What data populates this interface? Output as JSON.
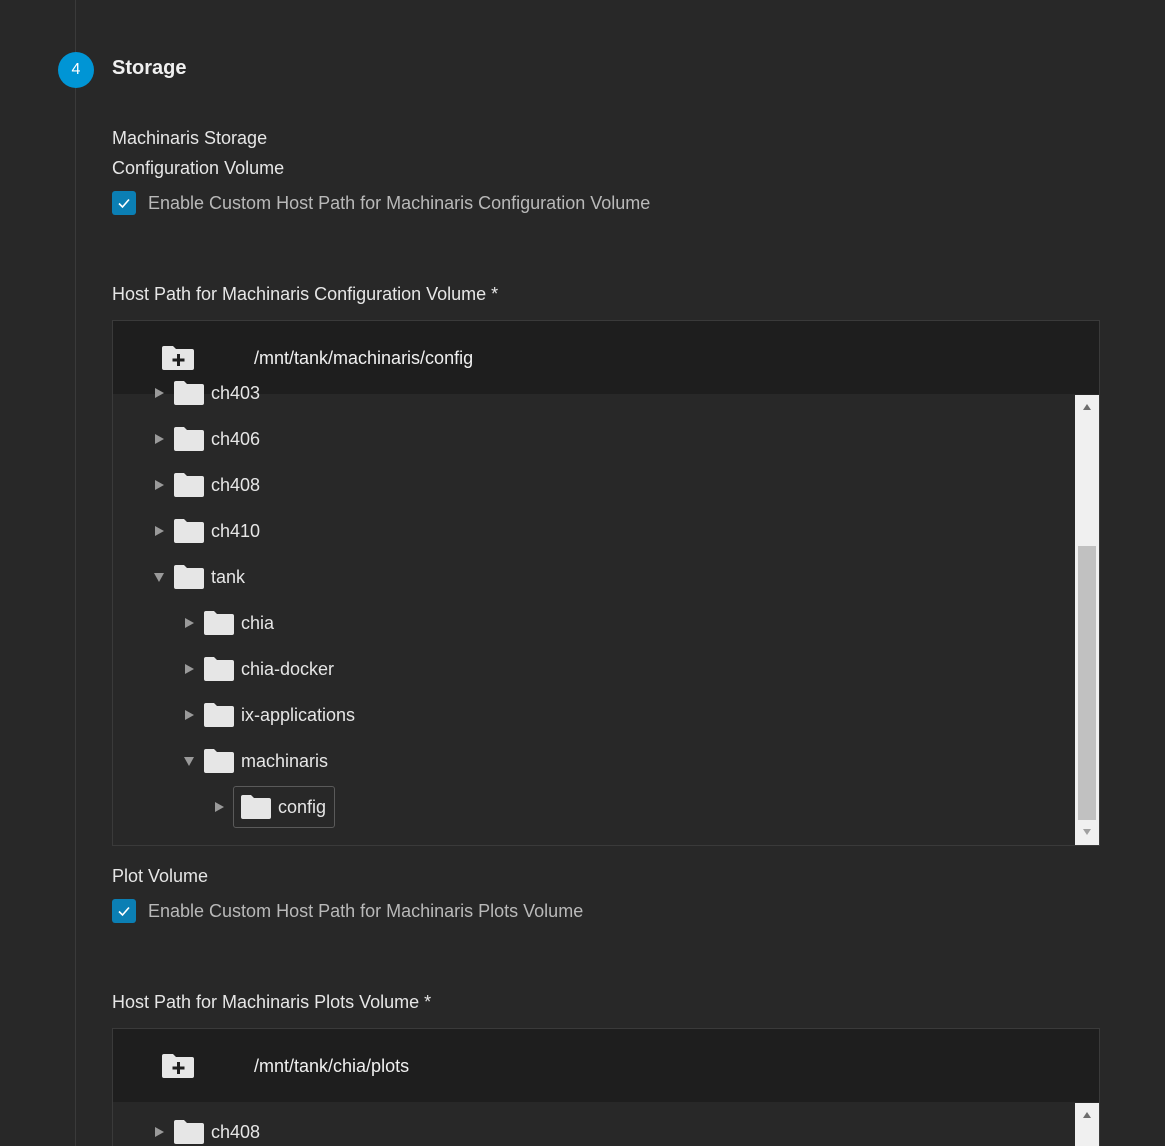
{
  "step": {
    "number": "4",
    "title": "Storage"
  },
  "section_label": "Machinaris Storage",
  "config_volume": {
    "label": "Configuration Volume",
    "checkbox_label": "Enable Custom Host Path for Machinaris Configuration Volume",
    "checked": true,
    "host_path_label": "Host Path for Machinaris Configuration Volume *",
    "path_value": "/mnt/tank/machinaris/config",
    "tree": [
      {
        "name": "ch403",
        "expanded": false
      },
      {
        "name": "ch406",
        "expanded": false
      },
      {
        "name": "ch408",
        "expanded": false
      },
      {
        "name": "ch410",
        "expanded": false
      },
      {
        "name": "tank",
        "expanded": true
      },
      {
        "name": "chia",
        "expanded": false
      },
      {
        "name": "chia-docker",
        "expanded": false
      },
      {
        "name": "ix-applications",
        "expanded": false
      },
      {
        "name": "machinaris",
        "expanded": true
      },
      {
        "name": "config",
        "expanded": false,
        "selected": true
      }
    ]
  },
  "plot_volume": {
    "label": "Plot Volume",
    "checkbox_label": "Enable Custom Host Path for Machinaris Plots Volume",
    "checked": true,
    "host_path_label": "Host Path for Machinaris Plots Volume *",
    "path_value": "/mnt/tank/chia/plots",
    "tree": [
      {
        "name": "ch408",
        "expanded": false
      }
    ]
  },
  "colors": {
    "accent": "#0095d5",
    "checkbox": "#0b7fb4",
    "background": "#282828",
    "header": "#1e1e1e"
  },
  "icons": {
    "new_folder": "folder-plus-icon",
    "folder": "folder-icon",
    "collapsed": "triangle-right-icon",
    "expanded": "triangle-down-icon",
    "check": "check-icon"
  }
}
